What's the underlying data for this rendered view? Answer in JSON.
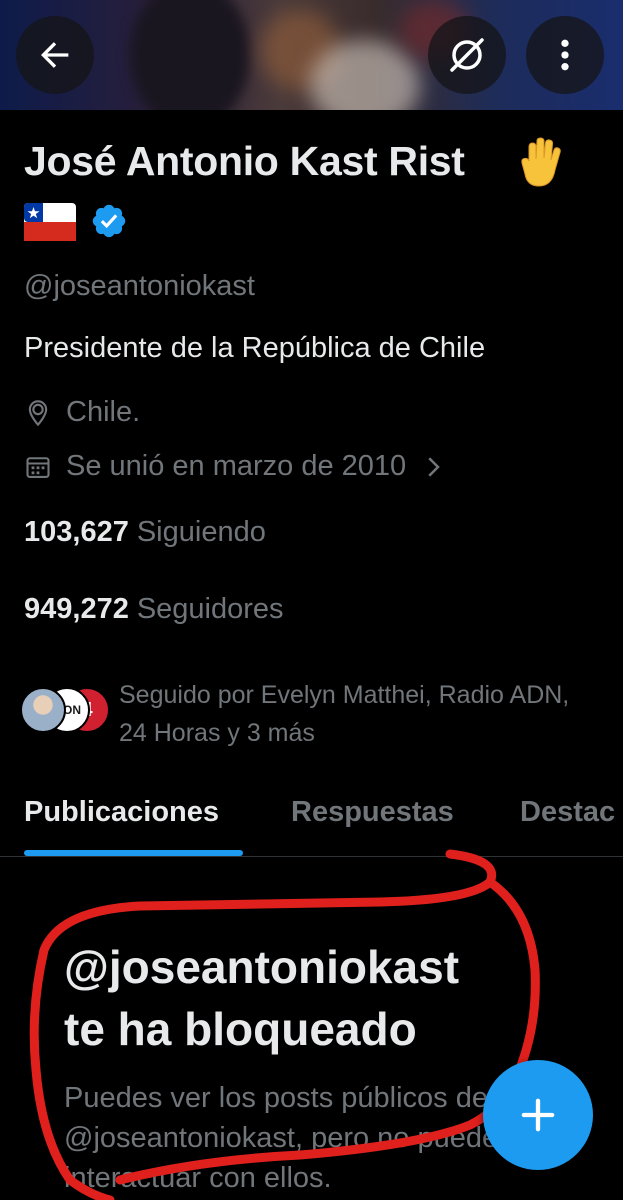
{
  "header": {
    "back_icon": "arrow-left-icon",
    "grok_icon": "grok-icon",
    "more_icon": "more-vertical-icon"
  },
  "profile": {
    "name": "José Antonio Kast Rist",
    "name_emoji": "raised-hand-emoji",
    "flag_emoji": "chile-flag",
    "verified": true,
    "handle": "@joseantoniokast",
    "bio": "Presidente de la República de Chile",
    "location": "Chile.",
    "joined": "Se unió en marzo de 2010"
  },
  "stats": {
    "following_count": "103,627",
    "following_label": "Siguiendo",
    "followers_count": "949,272",
    "followers_label": "Seguidores"
  },
  "followed_by": {
    "text": "Seguido por Evelyn Matthei, Radio ADN, 24 Horas y 3 más"
  },
  "tabs": [
    {
      "label": "Publicaciones",
      "active": true
    },
    {
      "label": "Respuestas",
      "active": false
    },
    {
      "label": "Destac",
      "active": false
    }
  ],
  "blocked": {
    "title_line1": "@joseantoniokast",
    "title_line2": "te ha bloqueado",
    "description": "Puedes ver los posts públicos de @joseantoniokast, pero no puedes interactuar con ellos."
  },
  "colors": {
    "accent": "#1d9bf0",
    "annotation": "#e0201c"
  }
}
